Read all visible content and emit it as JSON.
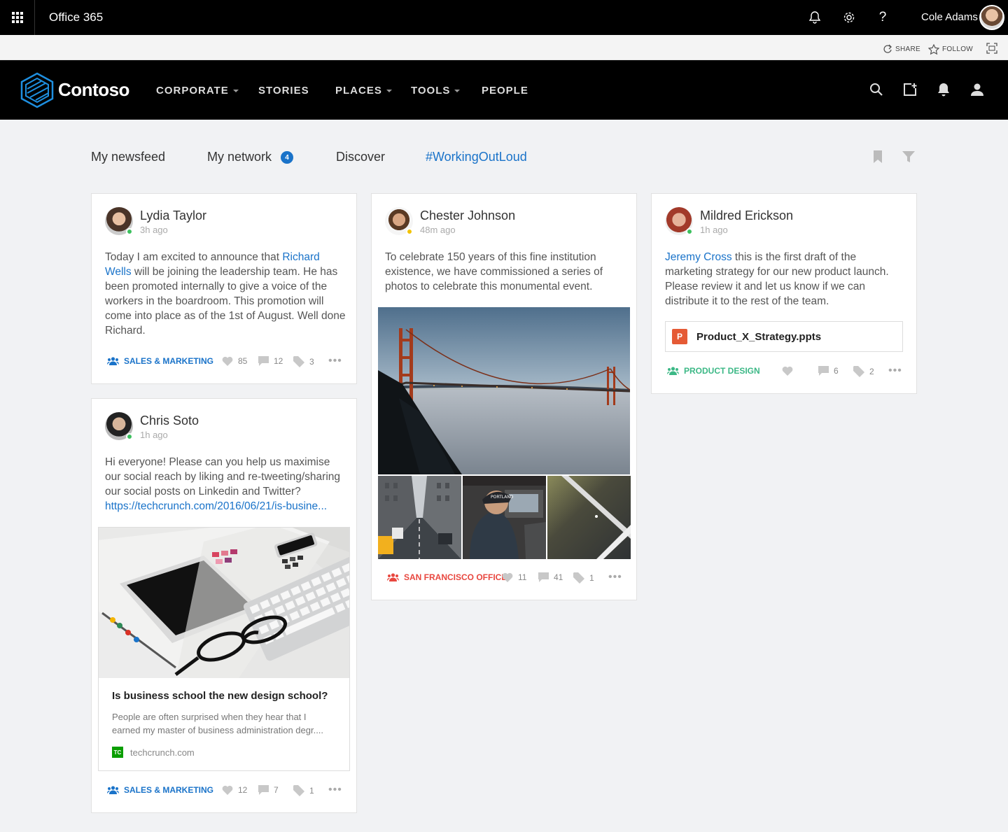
{
  "suite": {
    "title": "Office 365",
    "user_name": "Cole Adams",
    "icons": [
      "waffle-icon",
      "bell-icon",
      "gear-icon",
      "help-icon"
    ]
  },
  "sharebar": {
    "share": "SHARE",
    "follow": "FOLLOW"
  },
  "site": {
    "name": "Contoso",
    "nav": [
      {
        "label": "CORPORATE",
        "has_menu": true
      },
      {
        "label": "STORIES",
        "has_menu": false
      },
      {
        "label": "PLACES",
        "has_menu": true
      },
      {
        "label": "TOOLS",
        "has_menu": true
      },
      {
        "label": "PEOPLE",
        "has_menu": false
      }
    ]
  },
  "tabs": [
    {
      "label": "My newsfeed"
    },
    {
      "label": "My network",
      "badge": "4"
    },
    {
      "label": "Discover"
    },
    {
      "label": "#WorkingOutLoud",
      "active": true
    }
  ],
  "colors": {
    "blue": "#1a73c9",
    "red": "#e8473f",
    "teal": "#3cb886",
    "online": "#3cc05e",
    "away": "#f2c200"
  },
  "posts": {
    "lydia": {
      "name": "Lydia Taylor",
      "time": "3h ago",
      "text_before": "Today I am excited to announce that ",
      "mention": "Richard Wells",
      "text_after": " will be joining the leadership team. He has been promoted internally to give a voice of the workers in the boardroom. This promotion will come into place as of the 1st of August. Well done Richard.",
      "group": "SALES & MARKETING",
      "likes": "85",
      "comments": "12",
      "tags": "3"
    },
    "chris": {
      "name": "Chris Soto",
      "time": "1h ago",
      "text": "Hi everyone! Please can you help us maximise our social reach by liking and re-tweeting/sharing our social posts on Linkedin and Twitter?",
      "url": "https://techcrunch.com/2016/06/21/is-busine...",
      "preview_title": "Is business school the new design school?",
      "preview_desc": "People are often surprised when they hear that I earned my master of business administration degr....",
      "preview_source": "techcrunch.com",
      "group": "SALES & MARKETING",
      "likes": "12",
      "comments": "7",
      "tags": "1"
    },
    "chester": {
      "name": "Chester Johnson",
      "time": "48m ago",
      "text": "To celebrate 150 years of this fine institution existence, we have commissioned a series of photos to celebrate this monumental event.",
      "group": "SAN FRANCISCO OFFICE",
      "likes": "11",
      "comments": "41",
      "tags": "1"
    },
    "mildred": {
      "name": "Mildred Erickson",
      "time": "1h ago",
      "mention": "Jeremy Cross",
      "text_after": " this is the first draft of the marketing strategy for our new product launch. Please review it and let us know if we can distribute it to the rest of the team.",
      "file_icon": "P",
      "file": "Product_X_Strategy.ppts",
      "group": "PRODUCT DESIGN",
      "likes": "",
      "comments": "6",
      "tags": "2"
    }
  }
}
